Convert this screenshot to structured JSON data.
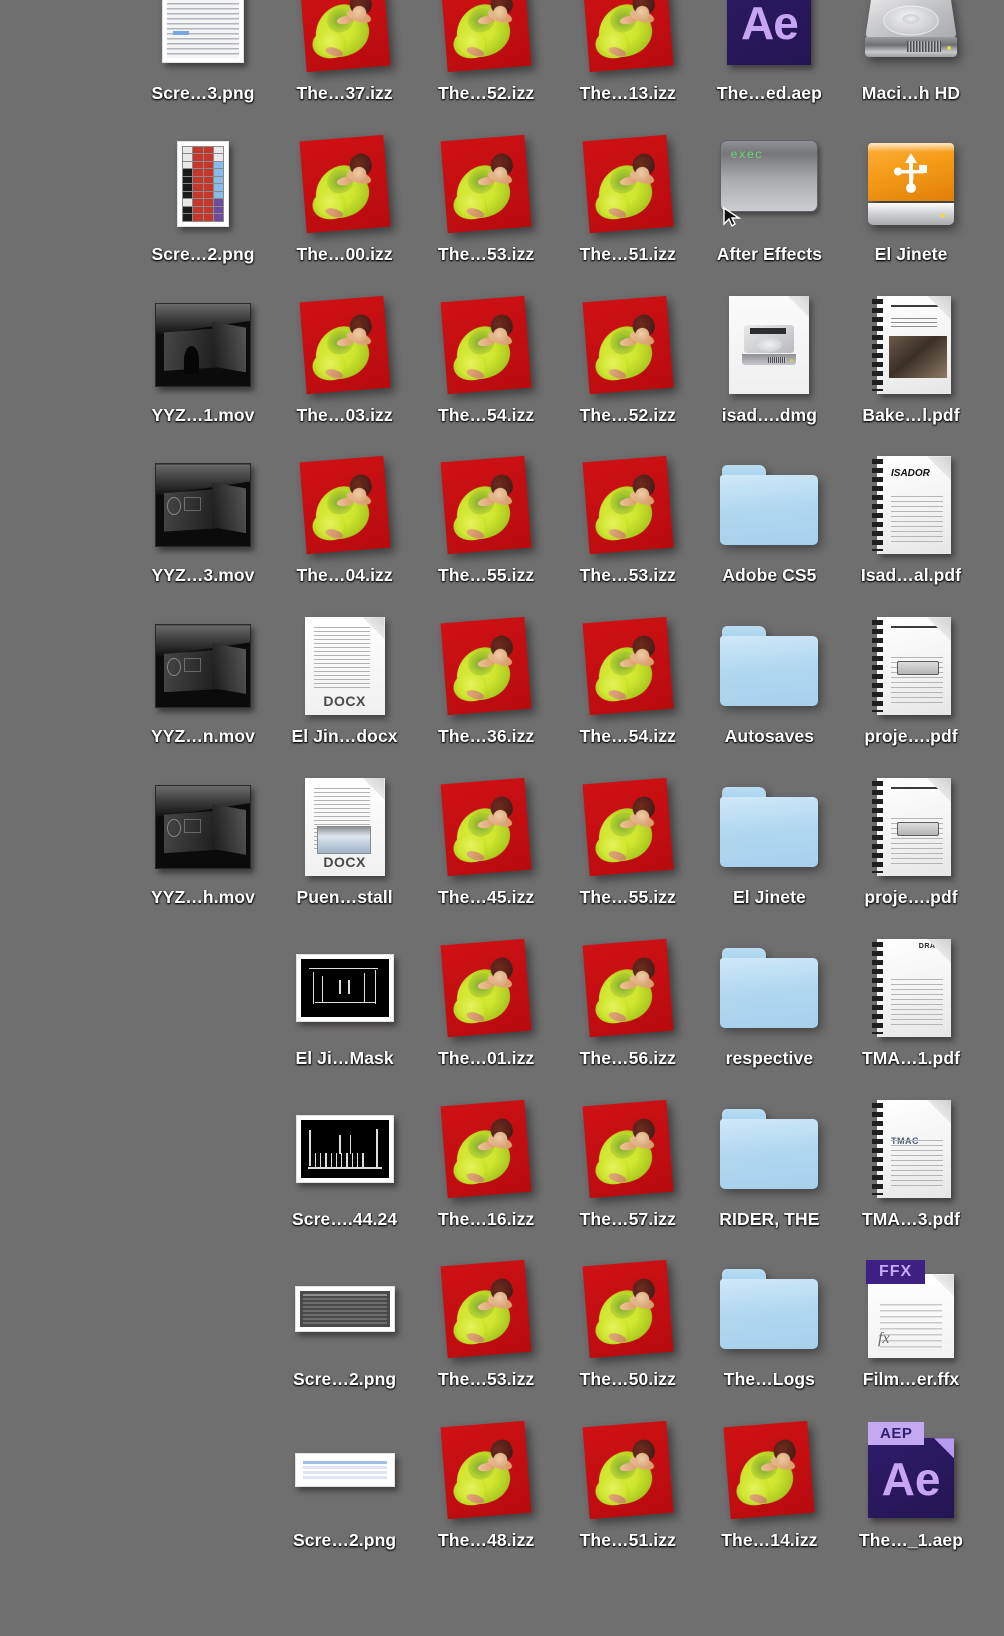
{
  "desktop": {
    "background_color": "#706f6f",
    "label_color": "#ffffff",
    "columns": 6,
    "rows": 10
  },
  "items": [
    {
      "label": "Scre…3.png",
      "icon": "png-screenshot-prefs",
      "col": 0,
      "row": 0
    },
    {
      "label": "The…37.izz",
      "icon": "izz-image",
      "col": 1,
      "row": 0
    },
    {
      "label": "The…52.izz",
      "icon": "izz-image",
      "col": 2,
      "row": 0
    },
    {
      "label": "The…13.izz",
      "icon": "izz-image",
      "col": 3,
      "row": 0
    },
    {
      "label": "The…ed.aep",
      "icon": "after-effects-app",
      "col": 4,
      "row": 0
    },
    {
      "label": "Maci…h HD",
      "icon": "hard-drive",
      "col": 5,
      "row": 0
    },
    {
      "label": "Scre…2.png",
      "icon": "png-screenshot-icons",
      "col": 0,
      "row": 1
    },
    {
      "label": "The…00.izz",
      "icon": "izz-image",
      "col": 1,
      "row": 1
    },
    {
      "label": "The…53.izz",
      "icon": "izz-image",
      "col": 2,
      "row": 1
    },
    {
      "label": "The…51.izz",
      "icon": "izz-image",
      "col": 3,
      "row": 1
    },
    {
      "label": "After Effects",
      "icon": "exec-terminal-alias",
      "col": 4,
      "row": 1
    },
    {
      "label": "El Jinete",
      "icon": "usb-drive",
      "col": 5,
      "row": 1
    },
    {
      "label": "YYZ…1.mov",
      "icon": "movie-thumbnail-arch",
      "col": 0,
      "row": 2
    },
    {
      "label": "The…03.izz",
      "icon": "izz-image",
      "col": 1,
      "row": 2
    },
    {
      "label": "The…54.izz",
      "icon": "izz-image",
      "col": 2,
      "row": 2
    },
    {
      "label": "The…52.izz",
      "icon": "izz-image",
      "col": 3,
      "row": 2
    },
    {
      "label": "isad….dmg",
      "icon": "disk-image-dmg",
      "col": 4,
      "row": 2
    },
    {
      "label": "Bake…l.pdf",
      "icon": "pdf-manual-photo",
      "col": 5,
      "row": 2
    },
    {
      "label": "YYZ…3.mov",
      "icon": "movie-thumbnail-room",
      "col": 0,
      "row": 3
    },
    {
      "label": "The…04.izz",
      "icon": "izz-image",
      "col": 1,
      "row": 3
    },
    {
      "label": "The…55.izz",
      "icon": "izz-image",
      "col": 2,
      "row": 3
    },
    {
      "label": "The…53.izz",
      "icon": "izz-image",
      "col": 3,
      "row": 3
    },
    {
      "label": "Adobe CS5",
      "icon": "folder",
      "col": 4,
      "row": 3
    },
    {
      "label": "Isad…al.pdf",
      "icon": "pdf-manual-isador",
      "col": 5,
      "row": 3
    },
    {
      "label": "YYZ…n.mov",
      "icon": "movie-thumbnail-room",
      "col": 0,
      "row": 4
    },
    {
      "label": "El Jin…docx",
      "icon": "docx-text",
      "col": 1,
      "row": 4
    },
    {
      "label": "The…36.izz",
      "icon": "izz-image",
      "col": 2,
      "row": 4
    },
    {
      "label": "The…54.izz",
      "icon": "izz-image",
      "col": 3,
      "row": 4
    },
    {
      "label": "Autosaves",
      "icon": "folder",
      "col": 4,
      "row": 4
    },
    {
      "label": "proje….pdf",
      "icon": "pdf-manual-projector",
      "col": 5,
      "row": 4
    },
    {
      "label": "YYZ…h.mov",
      "icon": "movie-thumbnail-room",
      "col": 0,
      "row": 5
    },
    {
      "label": "Puen…stall",
      "icon": "docx-image",
      "col": 1,
      "row": 5
    },
    {
      "label": "The…45.izz",
      "icon": "izz-image",
      "col": 2,
      "row": 5
    },
    {
      "label": "The…55.izz",
      "icon": "izz-image",
      "col": 3,
      "row": 5
    },
    {
      "label": "El Jinete",
      "icon": "folder",
      "col": 4,
      "row": 5
    },
    {
      "label": "proje….pdf",
      "icon": "pdf-manual-projector",
      "col": 5,
      "row": 5
    },
    {
      "label": "El Ji…Mask",
      "icon": "wireframe-thumbnail",
      "col": 1,
      "row": 6
    },
    {
      "label": "The…01.izz",
      "icon": "izz-image",
      "col": 2,
      "row": 6
    },
    {
      "label": "The…56.izz",
      "icon": "izz-image",
      "col": 3,
      "row": 6
    },
    {
      "label": "respective",
      "icon": "folder",
      "col": 4,
      "row": 6
    },
    {
      "label": "TMA…1.pdf",
      "icon": "pdf-manual-draft",
      "col": 5,
      "row": 6
    },
    {
      "label": "Scre….44.24",
      "icon": "wireframe-thumbnail-2",
      "col": 1,
      "row": 7
    },
    {
      "label": "The…16.izz",
      "icon": "izz-image",
      "col": 2,
      "row": 7
    },
    {
      "label": "The…57.izz",
      "icon": "izz-image",
      "col": 3,
      "row": 7
    },
    {
      "label": "RIDER, THE",
      "icon": "folder",
      "col": 4,
      "row": 7
    },
    {
      "label": "TMA…3.pdf",
      "icon": "pdf-manual-tmac",
      "col": 5,
      "row": 7
    },
    {
      "label": "Scre…2.png",
      "icon": "png-screenshot-log",
      "col": 1,
      "row": 8
    },
    {
      "label": "The…53.izz",
      "icon": "izz-image",
      "col": 2,
      "row": 8
    },
    {
      "label": "The…50.izz",
      "icon": "izz-image",
      "col": 3,
      "row": 8
    },
    {
      "label": "The…Logs",
      "icon": "folder",
      "col": 4,
      "row": 8
    },
    {
      "label": "Film…er.ffx",
      "icon": "ffx-preset-doc",
      "col": 5,
      "row": 8
    },
    {
      "label": "Scre…2.png",
      "icon": "png-screenshot-finder",
      "col": 1,
      "row": 9
    },
    {
      "label": "The…48.izz",
      "icon": "izz-image",
      "col": 2,
      "row": 9
    },
    {
      "label": "The…51.izz",
      "icon": "izz-image",
      "col": 3,
      "row": 9
    },
    {
      "label": "The…14.izz",
      "icon": "izz-image",
      "col": 4,
      "row": 9
    },
    {
      "label": "The…_1.aep",
      "icon": "aep-project-doc",
      "col": 5,
      "row": 9
    }
  ],
  "icon_text": {
    "exec_prompt": "exec",
    "after_effects_glyph": "Ae",
    "after_effects_tag": "AEP",
    "ffx_tag": "FFX",
    "ffx_fx": "fx",
    "aep_tag": "AEP",
    "aep_glyph": "Ae",
    "docx_kind": "DOCX",
    "isador_title": "ISADOR",
    "draft_stamp": "DRAFT",
    "tmac_title": "TMAC"
  },
  "colors": {
    "izz_red": "#c00d10",
    "izz_yellow": "#cfe62f",
    "folder_blue": "#b2d8f0",
    "ae_purple": "#2b1a63",
    "ae_glyph": "#c7a5f5",
    "usb_orange": "#f59b17",
    "terminal_green": "#66d96b"
  }
}
